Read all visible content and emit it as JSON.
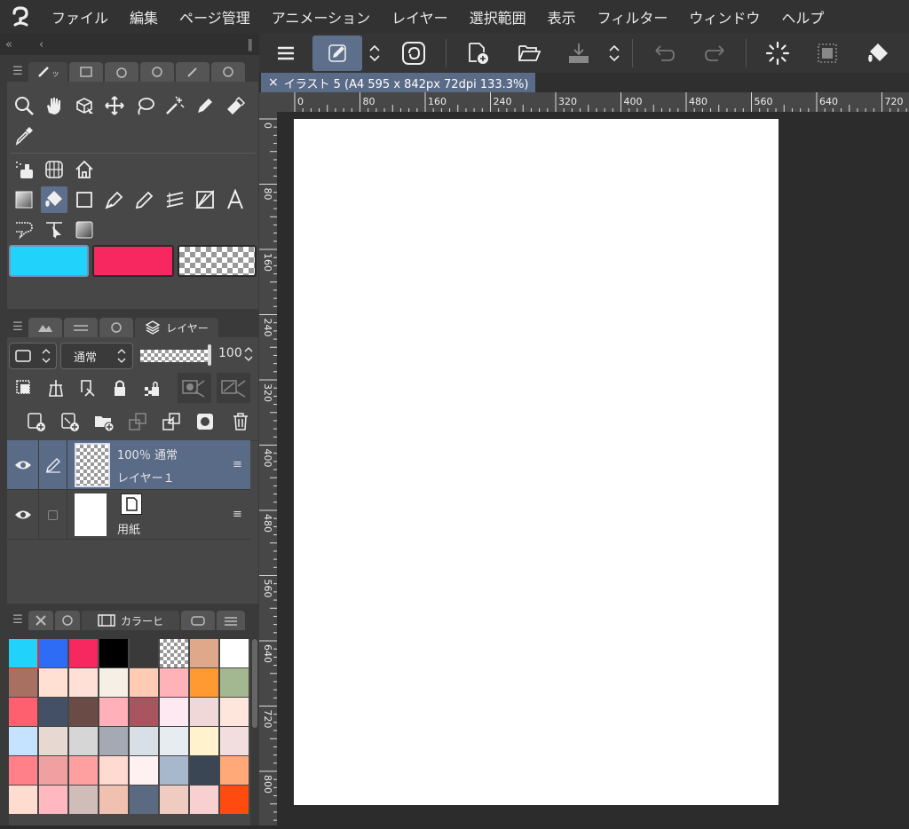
{
  "menu": [
    "ファイル",
    "編集",
    "ページ管理",
    "アニメーション",
    "レイヤー",
    "選択範囲",
    "表示",
    "フィルター",
    "ウィンドウ",
    "ヘルプ"
  ],
  "colors": {
    "main_color": "#21d3fb",
    "sub_color": "#f6285f",
    "accent": "#5e6f8c",
    "panel_bg": "#474747"
  },
  "tools": {
    "row1": [
      "zoom-icon",
      "hand-icon",
      "object-select-icon",
      "move-icon",
      "lasso-icon",
      "magic-wand-icon",
      "pen-icon",
      "eraser-icon"
    ],
    "row2": [
      "eyedropper-icon"
    ],
    "row3": [
      "gradient-brush-icon",
      "perspective-ruler-icon",
      "house-icon"
    ],
    "row4": [
      "gradient-fill-icon",
      "fill-bucket-icon",
      "rectangle-icon",
      "pen-nib-icon",
      "pencil-icon",
      "blend-icon",
      "triangle-ruler-icon",
      "text-icon"
    ],
    "row5": [
      "balloon-icon",
      "correct-line-icon",
      "gradient-icon"
    ]
  },
  "layer_panel": {
    "tab_label": "レイヤー",
    "blend_mode": "通常",
    "opacity": "100"
  },
  "layers": [
    {
      "title": "100％ 通常",
      "name": "レイヤー１",
      "selected": true
    },
    {
      "title": "",
      "name": "用紙",
      "selected": false
    }
  ],
  "toolbar_icons": [
    "menu-icon",
    "edit-icon",
    "updown-icon",
    "clip-studio-icon",
    "new-canvas-icon",
    "open-folder-icon",
    "save-icon",
    "updown-icon",
    "undo-icon",
    "redo-icon",
    "loading-icon",
    "selection-icon",
    "fill-icon"
  ],
  "document": {
    "tab_title": "イラスト 5 (A4 595 x 842px 72dpi 133.3%)"
  },
  "ruler": {
    "h_labels": [
      "0",
      "80",
      "160",
      "240",
      "320",
      "400",
      "480",
      "560",
      "640",
      "720"
    ],
    "v_labels": [
      "0",
      "80",
      "160",
      "240",
      "320",
      "400",
      "480",
      "560",
      "640",
      "720",
      "800"
    ]
  },
  "color_history": {
    "tab_label": "カラーヒ",
    "swatches": [
      "#21d3fb",
      "#2f6cf6",
      "#f6285f",
      "#000000",
      "#3a3a3a",
      "checker",
      "#e0a88a",
      "#ffffff",
      "#a87060",
      "#ffe0d2",
      "#ffe0d6",
      "#f5efe6",
      "#ffcbb3",
      "#ffb3b8",
      "#ff9a33",
      "#a3b890",
      "#ff6070",
      "#445066",
      "#6a4b45",
      "#ffb0b8",
      "#a85560",
      "#fee8f2",
      "#f0d8d8",
      "#fee6dc",
      "#c5e2ff",
      "#e8d8d2",
      "#d6d6d6",
      "#a4a9b4",
      "#d8dfe6",
      "#e6ecf0",
      "#fff2cc",
      "#f2dede",
      "#ff8088",
      "#f0a0a0",
      "#ffa0a0",
      "#ffdad0",
      "#fff0f2",
      "#a8b8cc",
      "#3a4654",
      "#ffa878",
      "#ffdcd0",
      "#ffb8c0",
      "#d0bcb8",
      "#f0c0b0",
      "#5a6a80",
      "#f0ccc0",
      "#f8d0d0",
      "#ff4a10"
    ]
  }
}
